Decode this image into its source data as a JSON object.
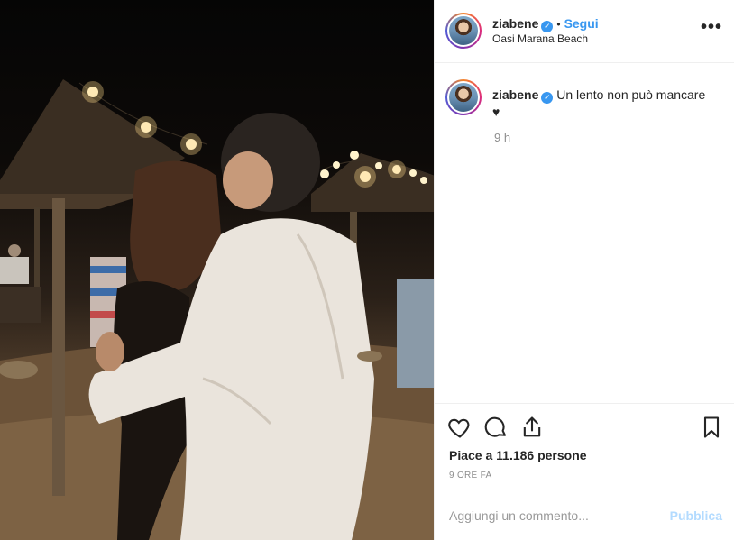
{
  "post": {
    "username": "ziabene",
    "verified_icon": "verified-badge-icon",
    "follow_label": "Segui",
    "separator": "•",
    "location": "Oasi Marana Beach",
    "more_icon": "more-options-icon",
    "more_label": "•••"
  },
  "comment": {
    "username": "ziabene",
    "caption": "Un lento non può mancare",
    "caption_emoji": "♥",
    "time": "9 h"
  },
  "actions": {
    "like_icon": "heart-icon",
    "comment_icon": "comment-icon",
    "share_icon": "share-icon",
    "save_icon": "bookmark-icon",
    "likes_text": "Piace a 11.186 persone",
    "posted_ago": "9 ORE FA"
  },
  "composer": {
    "placeholder": "Aggiungi un commento...",
    "publish_label": "Pubblica"
  },
  "colors": {
    "accent": "#3897f0",
    "publish_disabled": "#b3dbff",
    "text": "#262626",
    "muted": "#8e8e8e"
  }
}
